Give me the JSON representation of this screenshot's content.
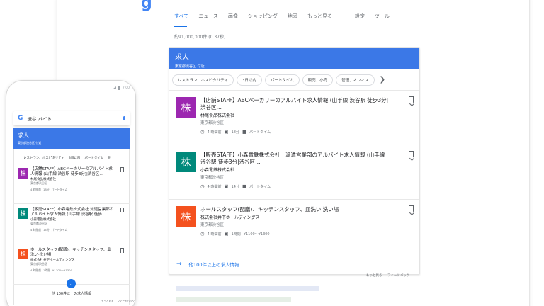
{
  "desktop": {
    "logo_fragment": "g",
    "tabs": [
      "すべて",
      "ニュース",
      "画像",
      "ショッピング",
      "地図",
      "もっと見る"
    ],
    "tools": [
      "設定",
      "ツール"
    ],
    "result_count": "約91,000,000件 (0.37秒)",
    "jobs": {
      "title": "求人",
      "subtitle": "東京都渋谷区 付近",
      "chips": [
        "レストラン、ホスピタリティ",
        "3日以内",
        "パートタイム",
        "販売、小売",
        "管理、オフィス"
      ],
      "items": [
        {
          "logo_char": "株",
          "logo_color": "#9c27b0",
          "title": "【店舗STAFF】ABCベーカリーのアルバイト求人情報 (山手線 渋谷駅 徒歩3分|渋谷区…",
          "company": "林尾食品株式会社",
          "location": "東京都渋谷区",
          "meta": [
            "4 時間前",
            "18分",
            "パートタイム"
          ]
        },
        {
          "logo_char": "株",
          "logo_color": "#00897b",
          "title": "【販売STAFF】小森電鉄株式会社　派遣営業部のアルバイト求人情報 (山手線 渋谷駅 徒歩3分|渋谷区…",
          "company": "小森電鉄株式会社",
          "location": "東京都渋谷区",
          "meta": [
            "4 時間前",
            "14分",
            "パートタイム"
          ]
        },
        {
          "logo_char": "株",
          "logo_color": "#f4511e",
          "title": "ホールスタッフ(配膳)、キッチンスタッフ、皿洗い·洗い場",
          "company": "株式会社井下ホールディングス",
          "location": "東京都渋谷区",
          "meta": [
            "4 時間前",
            "1時間",
            "¥1100～¥1300"
          ]
        }
      ],
      "more_jobs": "他100件以上の求人情報"
    },
    "footer_links": [
      "もっと見る",
      "フィードバック"
    ]
  },
  "phone": {
    "status_time": "7:00",
    "search_query": "渋谷 バイト",
    "jobs_title": "求人",
    "jobs_subtitle": "東京都渋谷区 付近",
    "chips": [
      "レストラン、ホスピタリティ",
      "3日以内",
      "パートタイム",
      "販"
    ],
    "items": [
      {
        "logo_char": "株",
        "logo_color": "#9c27b0",
        "title": "【店舗STAFF】ABCベーカリーのアルバイト求人情報 (山手線 渋谷駅 徒歩3分)|渋谷区…",
        "company": "林尾食品株式会社",
        "location": "東京都渋谷区",
        "meta": [
          "4 時間前",
          "18分",
          "パートタイム"
        ]
      },
      {
        "logo_char": "株",
        "logo_color": "#00897b",
        "title": "【販売STAFF】小森電鉄株式会社 派遣営業部のアルバイト求人情報 (山手線 渋谷駅 徒歩…",
        "company": "小森電鉄株式会社",
        "location": "東京都渋谷区",
        "meta": [
          "4 時間前",
          "14分",
          "パートタイム"
        ]
      },
      {
        "logo_char": "株",
        "logo_color": "#f4511e",
        "title": "ホールスタッフ(配膳)、キッチンスタッフ、皿洗い·洗い場",
        "company": "株式会社井下ホールディングス",
        "location": "東京都渋谷区",
        "meta": [
          "4 時間前",
          "1時間",
          "¥1100～¥1300"
        ]
      }
    ],
    "more_jobs": "他 100件以上の求人情報",
    "footer_links": [
      "もっと見る",
      "フィードバック"
    ]
  }
}
